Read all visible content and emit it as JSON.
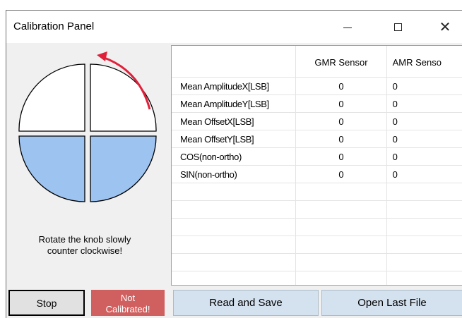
{
  "window": {
    "title": "Calibration Panel",
    "controls": {
      "minimize": "—",
      "maximize": "☐",
      "close": "✕"
    }
  },
  "knob": {
    "icon": "knob-quadrant-icon",
    "upper_color": "#ffffff",
    "lower_color": "#9dc3f0",
    "arrow_color": "#e0203a",
    "instruction_line1": "Rotate the knob slowly",
    "instruction_line2": "counter clockwise!"
  },
  "table": {
    "headers": [
      "",
      "GMR Sensor",
      "AMR Senso"
    ],
    "rows": [
      {
        "label": "Mean AmplitudeX[LSB]",
        "gmr": "0",
        "amr": "0"
      },
      {
        "label": "Mean AmplitudeY[LSB]",
        "gmr": "0",
        "amr": "0"
      },
      {
        "label": "Mean OffsetX[LSB]",
        "gmr": "0",
        "amr": "0"
      },
      {
        "label": "Mean OffsetY[LSB]",
        "gmr": "0",
        "amr": "0"
      },
      {
        "label": "COS(non-ortho)",
        "gmr": "0",
        "amr": "0"
      },
      {
        "label": "SIN(non-ortho)",
        "gmr": "0",
        "amr": "0"
      }
    ],
    "empty_rows": 6
  },
  "buttons": {
    "stop": "Stop",
    "read_and_save": "Read and Save",
    "open_last_file": "Open Last File"
  },
  "status": {
    "line1": "Not",
    "line2": "Calibrated!",
    "color": "#d06060"
  }
}
